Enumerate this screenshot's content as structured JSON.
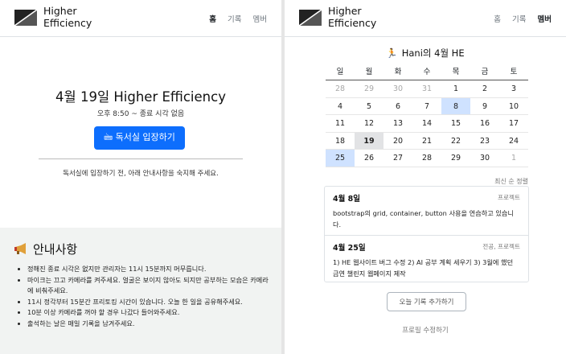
{
  "brand": {
    "line1": "Higher",
    "line2": "Efficiency"
  },
  "nav": {
    "home": "홈",
    "records": "기록",
    "members": "멤버"
  },
  "left": {
    "title": "4월 19일 Higher Efficiency",
    "time": "오후 8:50 ~ 종료 시각 없음",
    "enter_button": "🖮 독서실 입장하기",
    "note": "독서실에 입장하기 전, 아래 안내사항을 숙지해 주세요.",
    "notice_title": "안내사항",
    "notice_items": [
      "정해진 종료 시각은 없지만 관리자는 11시 15분까지 머무릅니다.",
      "마이크는 끄고 카메라를 켜주세요. 얼굴은 보이지 않아도 되지만 공부하는 모습은 카메라에 비춰주세요.",
      "11시 정각부터 15분간 프리토킹 시간이 있습니다. 오늘 한 일을 공유해주세요.",
      "10분 이상 카메라를 꺼야 할 경우 나갔다 들어와주세요.",
      "출석하는 날은 매일 기록을 남겨주세요."
    ]
  },
  "right": {
    "cal_title": "Hani의 4월 HE",
    "weekdays": [
      "일",
      "월",
      "화",
      "수",
      "목",
      "금",
      "토"
    ],
    "days": [
      {
        "d": "28",
        "s": "muted"
      },
      {
        "d": "29",
        "s": "muted"
      },
      {
        "d": "30",
        "s": "muted"
      },
      {
        "d": "31",
        "s": "muted"
      },
      {
        "d": "1",
        "s": ""
      },
      {
        "d": "2",
        "s": ""
      },
      {
        "d": "3",
        "s": ""
      },
      {
        "d": "4",
        "s": ""
      },
      {
        "d": "5",
        "s": ""
      },
      {
        "d": "6",
        "s": ""
      },
      {
        "d": "7",
        "s": ""
      },
      {
        "d": "8",
        "s": "hl"
      },
      {
        "d": "9",
        "s": ""
      },
      {
        "d": "10",
        "s": ""
      },
      {
        "d": "11",
        "s": ""
      },
      {
        "d": "12",
        "s": ""
      },
      {
        "d": "13",
        "s": ""
      },
      {
        "d": "14",
        "s": ""
      },
      {
        "d": "15",
        "s": ""
      },
      {
        "d": "16",
        "s": ""
      },
      {
        "d": "17",
        "s": ""
      },
      {
        "d": "18",
        "s": ""
      },
      {
        "d": "19",
        "s": "today"
      },
      {
        "d": "20",
        "s": ""
      },
      {
        "d": "21",
        "s": ""
      },
      {
        "d": "22",
        "s": ""
      },
      {
        "d": "23",
        "s": ""
      },
      {
        "d": "24",
        "s": ""
      },
      {
        "d": "25",
        "s": "hl"
      },
      {
        "d": "26",
        "s": ""
      },
      {
        "d": "27",
        "s": ""
      },
      {
        "d": "28",
        "s": ""
      },
      {
        "d": "29",
        "s": ""
      },
      {
        "d": "30",
        "s": ""
      },
      {
        "d": "1",
        "s": "muted"
      }
    ],
    "sort_link": "최신 순 정렬",
    "records": [
      {
        "date": "4월 8일",
        "tag": "프로젝트",
        "body": "bootstrap의 grid, container, button 사용을 연습하고 있습니다."
      },
      {
        "date": "4월 25일",
        "tag": "전공, 프로젝트",
        "body": "1) HE 웹사이트 버그 수정 2) AI 공부 계획 세우기 3) 3월에 했던 금연 챌린지 웹페이지 제작"
      }
    ],
    "add_button": "오늘 기록 추가하기",
    "profile_link": "프로필 수정하기"
  }
}
